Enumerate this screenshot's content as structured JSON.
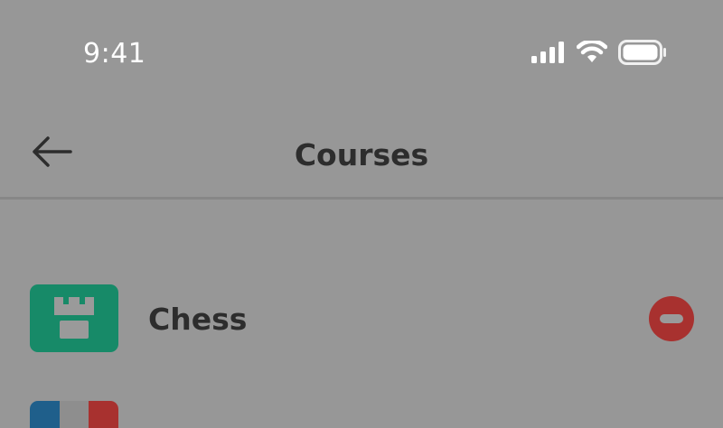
{
  "status_bar": {
    "time": "9:41",
    "icons": [
      "cellular-signal-icon",
      "wifi-icon",
      "battery-icon"
    ]
  },
  "nav": {
    "title": "Courses",
    "back_icon": "arrow-left-icon"
  },
  "courses": [
    {
      "label": "Chess",
      "icon": "chess-rook-icon",
      "icon_color": "#178a68",
      "action_icon": "minus-circle-icon",
      "action_color": "#a8312f"
    },
    {
      "label": "",
      "icon": "flag-icon",
      "icon_colors": [
        "#1f5f8b",
        "#8e8e8e",
        "#a8312f"
      ]
    }
  ]
}
